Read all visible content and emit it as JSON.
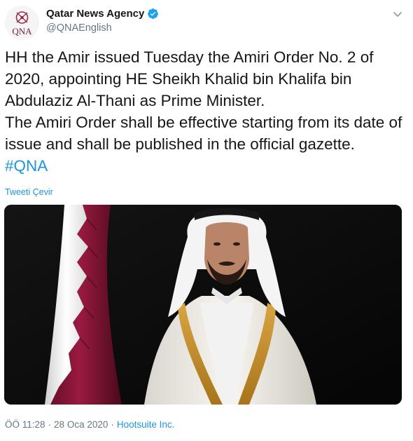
{
  "account": {
    "display_name": "Qatar News Agency",
    "handle": "@QNAEnglish",
    "avatar_text": "QNA",
    "verified": true
  },
  "tweet": {
    "text": "HH the Amir issued Tuesday the Amiri Order No. 2 of 2020, appointing HE Sheikh Khalid bin Khalifa bin Abdulaziz Al-Thani as Prime Minister.\nThe Amiri Order shall be effective starting from its date of issue and shall be published in the official gazette.",
    "hashtag": "#QNA",
    "translate_label": "Tweeti Çevir"
  },
  "footer": {
    "time": "ÖÖ 11:28",
    "separator": "·",
    "date": "28 Oca 2020",
    "source": "Hootsuite Inc."
  },
  "colors": {
    "link": "#1b95e0",
    "muted": "#657786",
    "text": "#14171a",
    "flag_maroon": "#8a1538",
    "verified": "#1da1f2"
  },
  "icons": {
    "verified": "verified-badge-icon",
    "menu": "chevron-down-icon"
  }
}
